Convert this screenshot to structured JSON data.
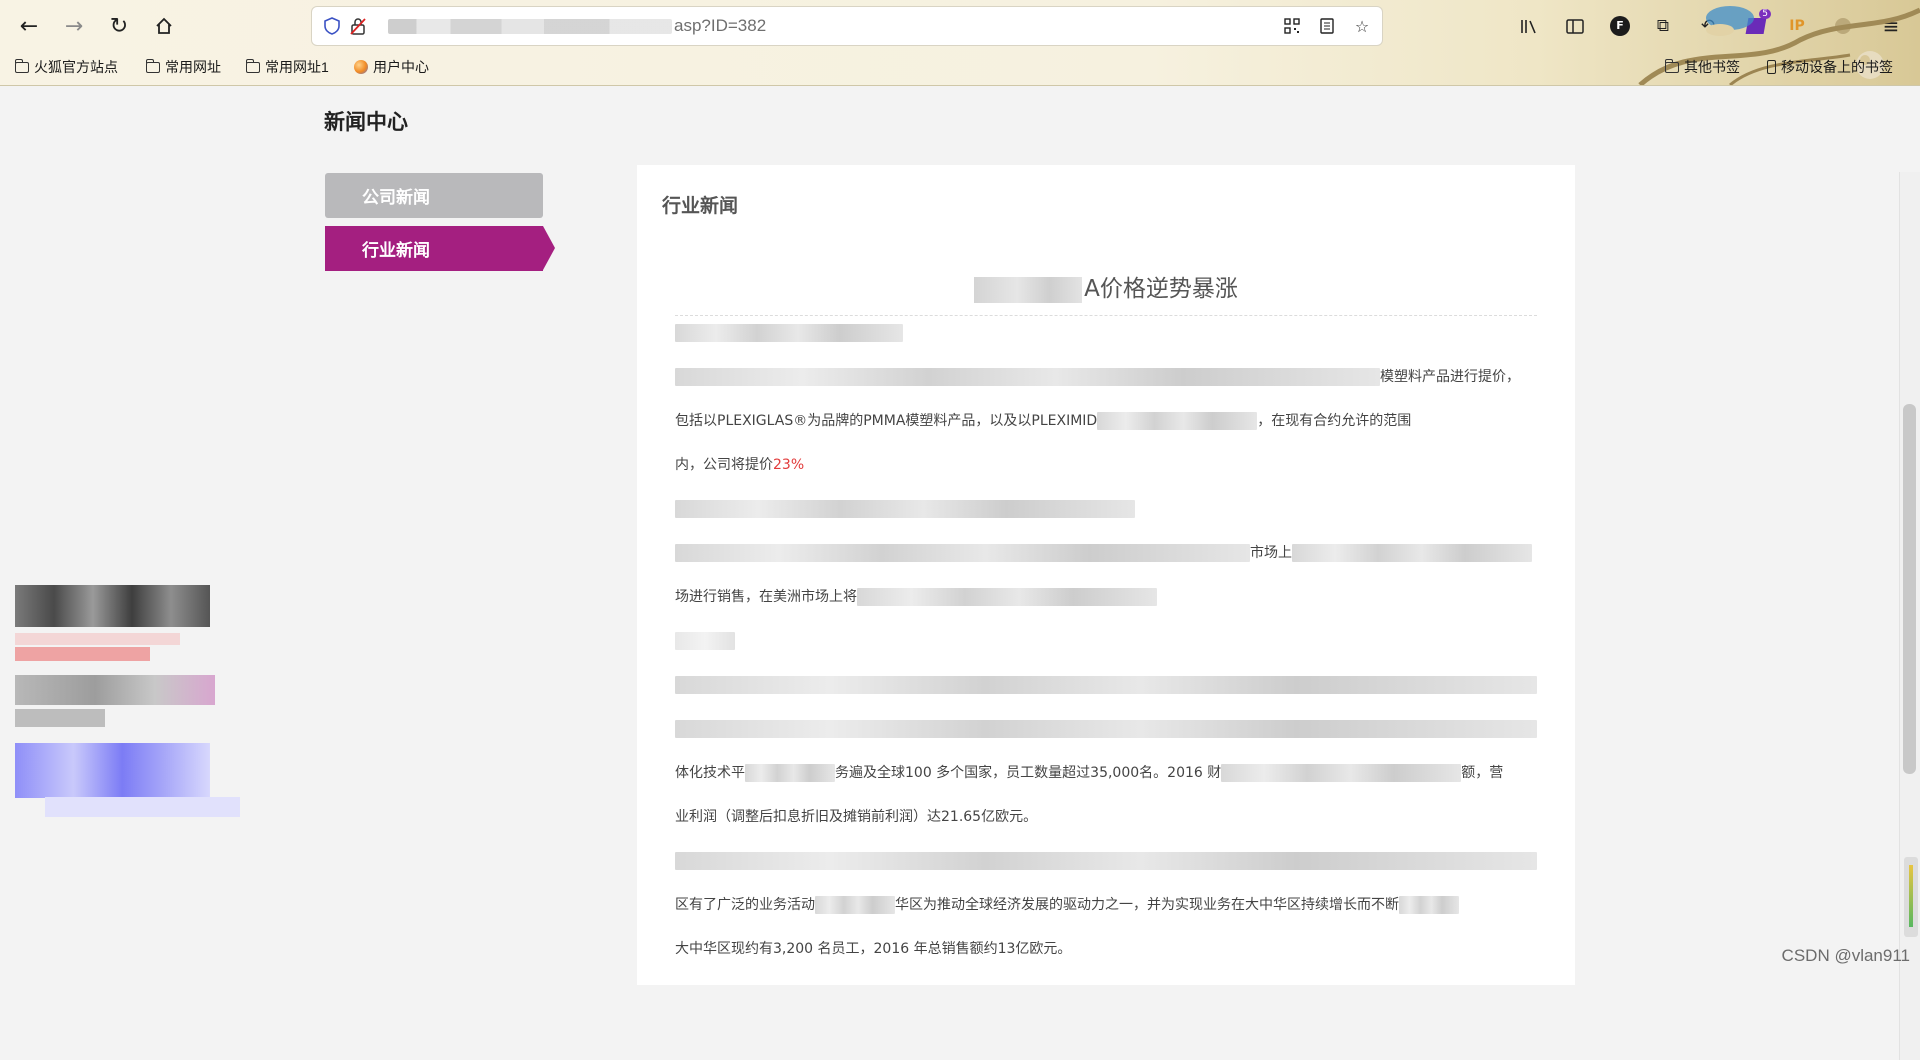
{
  "browser": {
    "url_suffix": "asp?ID=382",
    "bookmarks": [
      "火狐官方站点",
      "常用网址",
      "常用网址1",
      "用户中心"
    ],
    "bookmarks_right": [
      "其他书签",
      "移动设备上的书签"
    ],
    "icons": {
      "back": "back-arrow-icon",
      "forward": "forward-arrow-icon",
      "reload": "reload-icon",
      "home": "home-icon",
      "shield": "tracking-shield-icon",
      "lock": "insecure-lock-icon",
      "qr": "qr-code-icon",
      "reader": "reader-view-icon",
      "star": "bookmark-star-icon",
      "library": "library-icon",
      "sidebar": "sidebar-icon",
      "menu": "hamburger-menu-icon"
    },
    "ext_badge": "5",
    "ext_ip": "IP",
    "ext_f": "F"
  },
  "page": {
    "section_title": "新闻中心",
    "nav": [
      {
        "label": "公司新闻",
        "state": "inactive"
      },
      {
        "label": "行业新闻",
        "state": "active"
      }
    ],
    "panel_title": "行业新闻",
    "article": {
      "title_visible": "A价格逆势暴涨",
      "p1_tail": "模塑料产品进行提价，",
      "p2_start": "包括以PLEXIGLAS®为品牌的PMMA模塑料产品，以及以PLEXIMID",
      "p2_tail": "，在现有合约允许的范围",
      "p3_start": "内，公司将提价",
      "p3_red": "23%",
      "p4_mid": "市场上",
      "p5_start": "场进行销售，在美洲市场上将",
      "p6_start": "体化技术平",
      "p6_mid": "务遍及全球100 多个国家，员工数量超过35,000名。2016 财",
      "p6_tail": "额，营",
      "p7": "业利润（调整后扣息折旧及摊销前利润）达21.65亿欧元。",
      "p8_start": "区有了广泛的业务活动",
      "p8_mid": "华区为推动全球经济发展的驱动力之一，并为实现业务在大中华区持续增长而不断",
      "p9": "大中华区现约有3,200 名员工，2016 年总销售额约13亿欧元。"
    }
  },
  "watermark": "CSDN @vlan911",
  "colors": {
    "accent_purple": "#a41f80",
    "inactive_gray": "#b9b9bb",
    "highlight_red": "#e23b3b"
  }
}
